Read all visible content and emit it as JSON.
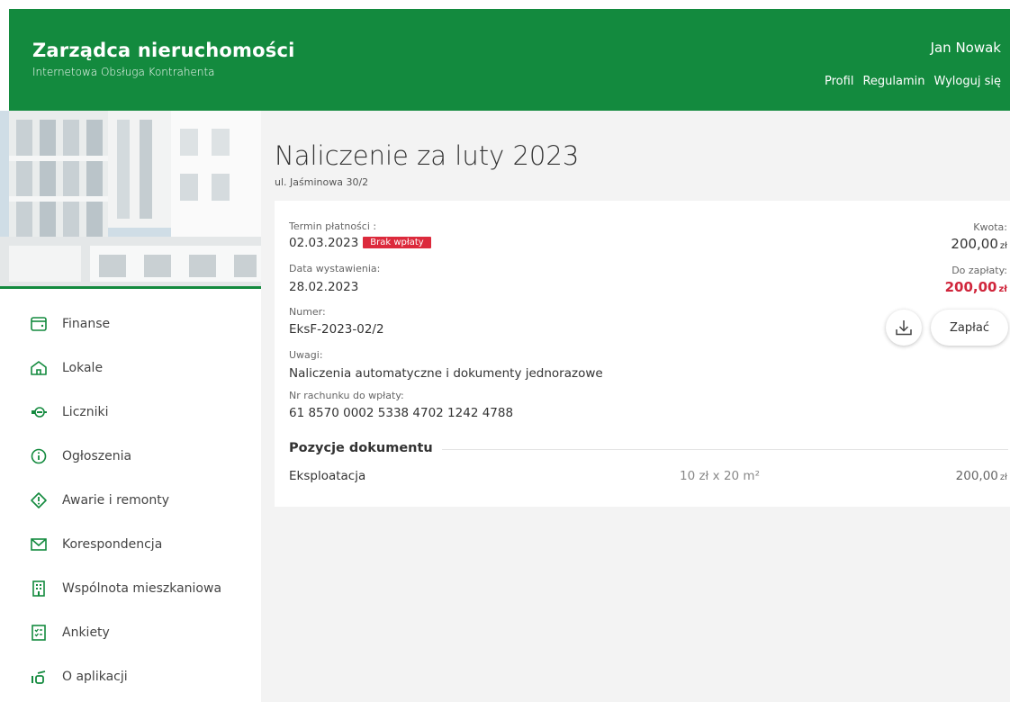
{
  "header": {
    "title": "Zarządca nieruchomości",
    "subtitle": "Internetowa Obsługa Kontrahenta",
    "user": "Jan Nowak",
    "links": [
      "Profil",
      "Regulamin",
      "Wyloguj się"
    ]
  },
  "nav": {
    "items": [
      {
        "label": "Finanse",
        "icon": "wallet-icon"
      },
      {
        "label": "Lokale",
        "icon": "home-icon"
      },
      {
        "label": "Liczniki",
        "icon": "meter-icon"
      },
      {
        "label": "Ogłoszenia",
        "icon": "info-icon"
      },
      {
        "label": "Awarie i remonty",
        "icon": "alert-icon"
      },
      {
        "label": "Korespondencja",
        "icon": "mail-icon"
      },
      {
        "label": "Wspólnota mieszkaniowa",
        "icon": "building-icon"
      },
      {
        "label": "Ankiety",
        "icon": "checklist-icon"
      },
      {
        "label": "O aplikacji",
        "icon": "about-icon"
      }
    ]
  },
  "page": {
    "title": "Naliczenie za luty 2023",
    "address": "ul. Jaśminowa 30/2"
  },
  "document": {
    "due_date_label": "Termin płatności :",
    "due_date": "02.03.2023",
    "status_badge": "Brak wpłaty",
    "issue_date_label": "Data wystawienia:",
    "issue_date": "28.02.2023",
    "number_label": "Numer:",
    "number": "EksF-2023-02/2",
    "notes_label": "Uwagi:",
    "notes": "Naliczenia automatyczne i dokumenty jednorazowe",
    "account_label": "Nr rachunku do wpłaty:",
    "account": "61 8570 0002 5338 4702 1242 4788",
    "amount_label": "Kwota:",
    "amount": "200,00",
    "to_pay_label": "Do zapłaty:",
    "to_pay": "200,00",
    "currency": "zł",
    "pay_button": "Zapłać"
  },
  "positions": {
    "title": "Pozycje dokumentu",
    "rows": [
      {
        "name": "Eksploatacja",
        "calc": "10 zł x 20 m²",
        "amount": "200,00",
        "currency": "zł"
      }
    ]
  },
  "colors": {
    "brand": "#138a3e",
    "danger": "#dc2a3c"
  }
}
